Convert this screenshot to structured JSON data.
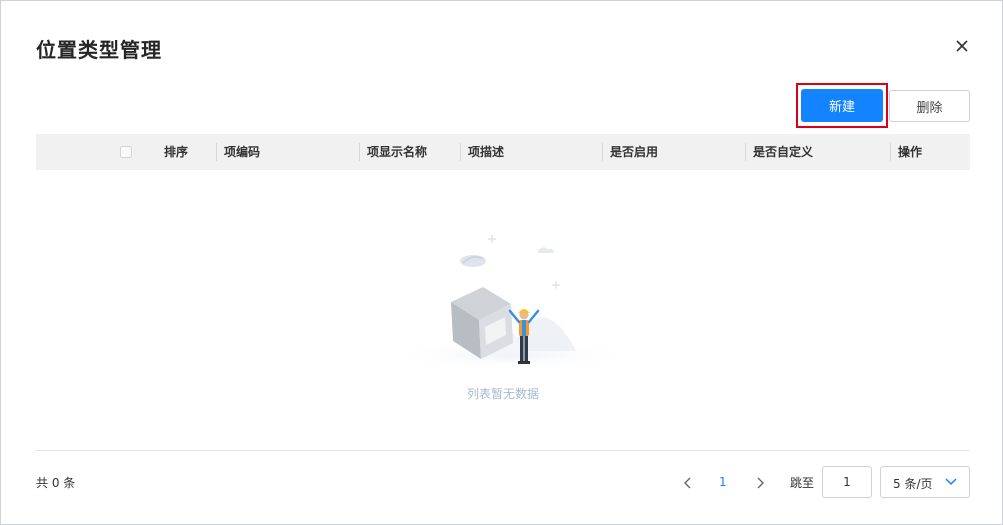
{
  "dialog": {
    "title": "位置类型管理"
  },
  "toolbar": {
    "new_label": "新建",
    "delete_label": "删除"
  },
  "table": {
    "columns": [
      "排序",
      "项编码",
      "项显示名称",
      "项描述",
      "是否启用",
      "是否自定义",
      "操作"
    ],
    "empty_text": "列表暂无数据"
  },
  "footer": {
    "total": "共 0 条",
    "current_page": "1",
    "jump_label": "跳至",
    "jump_value": "1",
    "page_size": "5 条/页"
  },
  "colors": {
    "primary": "#1483ff",
    "highlight": "#d9001b"
  },
  "icons": {
    "close": "close-icon",
    "prev": "chevron-left-icon",
    "next": "chevron-right-icon",
    "dropdown": "chevron-down-icon"
  }
}
